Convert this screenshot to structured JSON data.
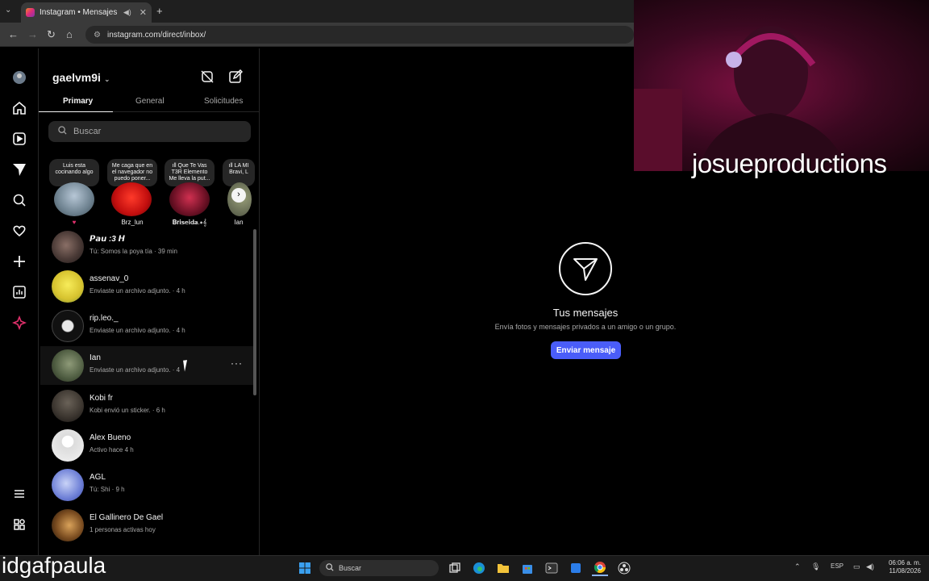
{
  "browser": {
    "tab_title": "Instagram • Mensajes",
    "url": "instagram.com/direct/inbox/"
  },
  "inbox": {
    "username": "gaelvm9i",
    "tabs": [
      "Primary",
      "General",
      "Solicitudes"
    ],
    "search_placeholder": "Buscar"
  },
  "notes": [
    {
      "text": "Luis esta cocinando algo",
      "name": ""
    },
    {
      "text": "Me caga que en el navegador no puedo poner...",
      "name": "Brz_lun"
    },
    {
      "text": "ıll Que Te Vas  T3R Elemento  Me lleva la put...",
      "name": "𝐁𝐫𝐢𝐬𝐞𝐢𝐝𝐚.∗𝄞"
    },
    {
      "text": "ıll LA MI  Bravi, L",
      "name": "Ian"
    }
  ],
  "conversations": [
    {
      "name": "𝙋𝙖𝙪 :3 𝙃",
      "preview": "Tú: Somos la poya tía · 39 min"
    },
    {
      "name": "assenav_0",
      "preview": "Enviaste un archivo adjunto. · 4 h"
    },
    {
      "name": "rip.leo._",
      "preview": "Enviaste un archivo adjunto. · 4 h"
    },
    {
      "name": "Ian",
      "preview": "Enviaste un archivo adjunto. · 4"
    },
    {
      "name": "Kobi fr",
      "preview": "Kobi envió un sticker. · 6 h"
    },
    {
      "name": "Alex Bueno",
      "preview": "Activo hace 4 h"
    },
    {
      "name": "AGL",
      "preview": "Tú: Shi · 9 h"
    },
    {
      "name": "El Gallinero De Gael",
      "preview": "1 personas activas hoy"
    }
  ],
  "empty_state": {
    "title": "Tus mensajes",
    "subtitle": "Envía fotos y mensajes privados a un amigo o un grupo.",
    "button": "Enviar mensaje"
  },
  "overlay": {
    "streamer": "josueproductions",
    "caption": "idgafpaula"
  },
  "taskbar": {
    "search": "Buscar",
    "lang": "ESP",
    "time": "06:06 a. m.",
    "date": "11/08/2026"
  },
  "colors": {
    "accent_button": "#4a5df9",
    "background": "#000000",
    "note_bg": "#262626"
  }
}
